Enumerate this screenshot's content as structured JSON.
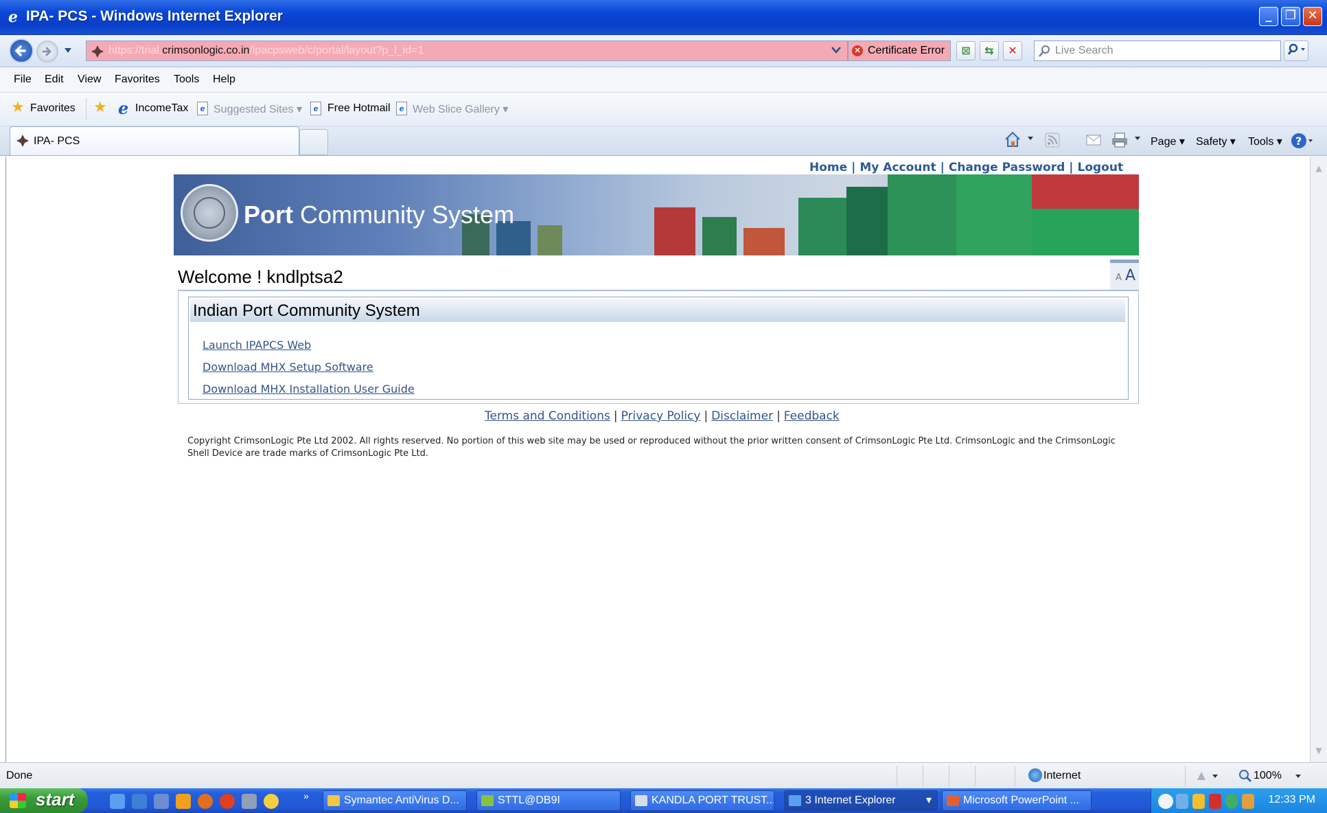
{
  "window": {
    "title": "IPA- PCS - Windows Internet Explorer"
  },
  "navbar": {
    "url_scheme": "https://trial.",
    "url_host": "crimsonlogic.co.in",
    "url_path": "/ipacpsweb/c/portal/layout?p_l_id=1",
    "certificate_error": "Certificate Error",
    "search_placeholder": "Live Search"
  },
  "menu": {
    "items": [
      "File",
      "Edit",
      "View",
      "Favorites",
      "Tools",
      "Help"
    ]
  },
  "favorites_bar": {
    "favorites_label": "Favorites",
    "items": [
      {
        "label": "IncomeTax"
      },
      {
        "label": "Suggested Sites ▾"
      },
      {
        "label": "Free Hotmail"
      },
      {
        "label": "Web Slice Gallery ▾"
      }
    ]
  },
  "tabs": {
    "active_label": "IPA- PCS"
  },
  "command_bar": {
    "page": "Page ▾",
    "safety": "Safety ▾",
    "tools": "Tools ▾"
  },
  "page": {
    "top_links": [
      "Home",
      "My Account",
      "Change Password",
      "Logout"
    ],
    "banner_brand_bold": "Port",
    "banner_brand_rest": " Community System",
    "welcome": "Welcome ! kndlptsa2",
    "font_small": "A",
    "font_large": "A",
    "portlet_title": "Indian Port Community System",
    "links": [
      "Launch IPAPCS Web",
      "Download MHX Setup Software",
      "Download MHX Installation User Guide"
    ],
    "footer_links": [
      "Terms and Conditions",
      "Privacy Policy",
      "Disclaimer",
      "Feedback"
    ],
    "copyright": "Copyright CrimsonLogic Pte Ltd 2002. All rights reserved. No portion of this web site may be used or reproduced without the prior written consent of CrimsonLogic Pte Ltd. CrimsonLogic and the CrimsonLogic Shell Device are trade marks of CrimsonLogic Pte Ltd."
  },
  "statusbar": {
    "status": "Done",
    "zone": "Internet",
    "zoom": "100%"
  },
  "taskbar": {
    "start": "start",
    "tasks": [
      "Symantec AntiVirus D...",
      "STTL@DB9I",
      "KANDLA PORT TRUST...",
      "3 Internet Explorer",
      "Microsoft PowerPoint ..."
    ],
    "clock": "12:33 PM"
  },
  "colors": {
    "titlebar": "#0a48d8",
    "address_error": "#f4aab4",
    "link": "#33548a",
    "toplink": "#2c5a95",
    "taskbar": "#245fdc",
    "start": "#3a9a3a"
  }
}
